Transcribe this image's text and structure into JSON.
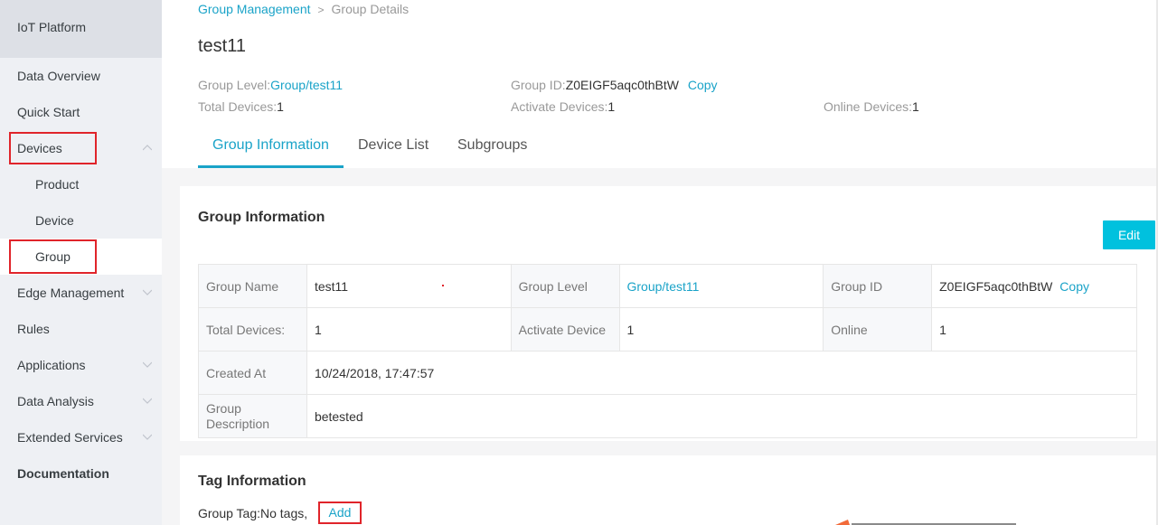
{
  "sidebar": {
    "title": "IoT Platform",
    "items": [
      {
        "label": "Data Overview"
      },
      {
        "label": "Quick Start"
      },
      {
        "label": "Devices"
      },
      {
        "label": "Product"
      },
      {
        "label": "Device"
      },
      {
        "label": "Group"
      },
      {
        "label": "Edge Management"
      },
      {
        "label": "Rules"
      },
      {
        "label": "Applications"
      },
      {
        "label": "Data Analysis"
      },
      {
        "label": "Extended Services"
      },
      {
        "label": "Documentation"
      }
    ]
  },
  "breadcrumb": {
    "parent": "Group Management",
    "separator": ">",
    "current": "Group Details"
  },
  "page_title": "test11",
  "summary": {
    "group_level_label": "Group Level:",
    "group_level_value": "Group/test11",
    "group_id_label": "Group ID:",
    "group_id_value": "Z0EIGF5aqc0thBtW",
    "copy_label": "Copy",
    "total_devices_label": "Total Devices:",
    "total_devices_value": "1",
    "activate_devices_label": "Activate Devices:",
    "activate_devices_value": "1",
    "online_devices_label": "Online Devices:",
    "online_devices_value": "1"
  },
  "tabs": [
    {
      "label": "Group Information"
    },
    {
      "label": "Device List"
    },
    {
      "label": "Subgroups"
    }
  ],
  "group_info": {
    "title": "Group Information",
    "edit_label": "Edit",
    "rows": {
      "group_name_label": "Group Name",
      "group_name_value": "test11",
      "group_level_label": "Group Level",
      "group_level_value": "Group/test11",
      "group_id_label": "Group ID",
      "group_id_value": "Z0EIGF5aqc0thBtW",
      "copy_label": "Copy",
      "total_devices_label": "Total Devices:",
      "total_devices_value": "1",
      "activate_device_label": "Activate Device",
      "activate_device_value": "1",
      "online_label": "Online",
      "online_value": "1",
      "created_at_label": "Created At",
      "created_at_value": "10/24/2018, 17:47:57",
      "description_label": "Group Description",
      "description_value": "betested"
    }
  },
  "tag_info": {
    "title": "Tag Information",
    "group_tag_text": "Group Tag:No tags,",
    "add_label": "Add"
  },
  "colors": {
    "accent": "#1aa3c8",
    "button": "#00c1de",
    "highlight_border": "#e0242a",
    "arrow": "#f26b3a"
  }
}
